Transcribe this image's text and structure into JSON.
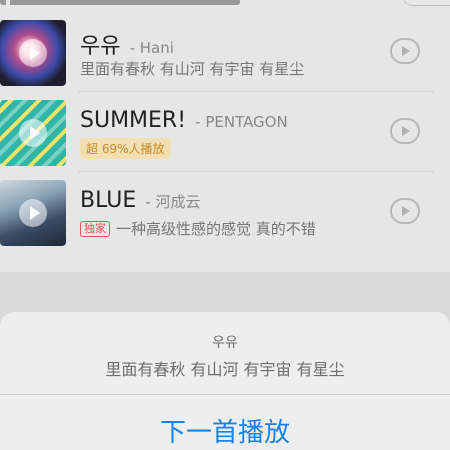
{
  "songs": [
    {
      "title": "우유",
      "artist": "- Hani",
      "subtitle": "里面有春秋 有山河 有宇宙 有星尘",
      "cover_icon": "play-icon",
      "action_icon": "play-circle-icon"
    },
    {
      "title": "SUMMER!",
      "artist": "- PENTAGON",
      "badge": "超 69%人播放",
      "cover_icon": "play-icon",
      "action_icon": "play-circle-icon"
    },
    {
      "title": "BLUE",
      "artist": "- 河成云",
      "tag": "独家",
      "subtitle": "一种高级性感的感觉 真的不错",
      "cover_icon": "play-icon",
      "action_icon": "play-circle-icon"
    }
  ],
  "action_sheet": {
    "title": "우유",
    "subtitle": "里面有春秋 有山河 有宇宙 有星尘",
    "action_label": "下一首播放"
  },
  "colors": {
    "accent": "#1a82e8",
    "hot_badge": "#c98a2a",
    "exclusive_tag": "#e05858"
  }
}
